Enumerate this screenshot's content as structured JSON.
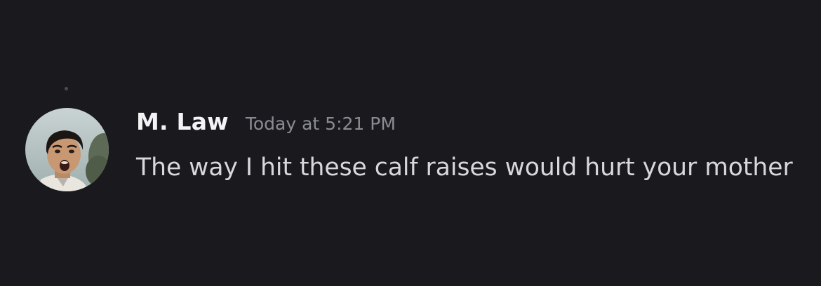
{
  "message": {
    "author": "M. Law",
    "timestamp": "Today at 5:21 PM",
    "text": "The way I hit these calf raises would hurt your mother",
    "avatar_icon": "user-avatar-photo"
  },
  "colors": {
    "background": "#1a1a1e",
    "username": "#f2f3f5",
    "timestamp": "#8a8c94",
    "message_text": "#d6d8dc"
  }
}
